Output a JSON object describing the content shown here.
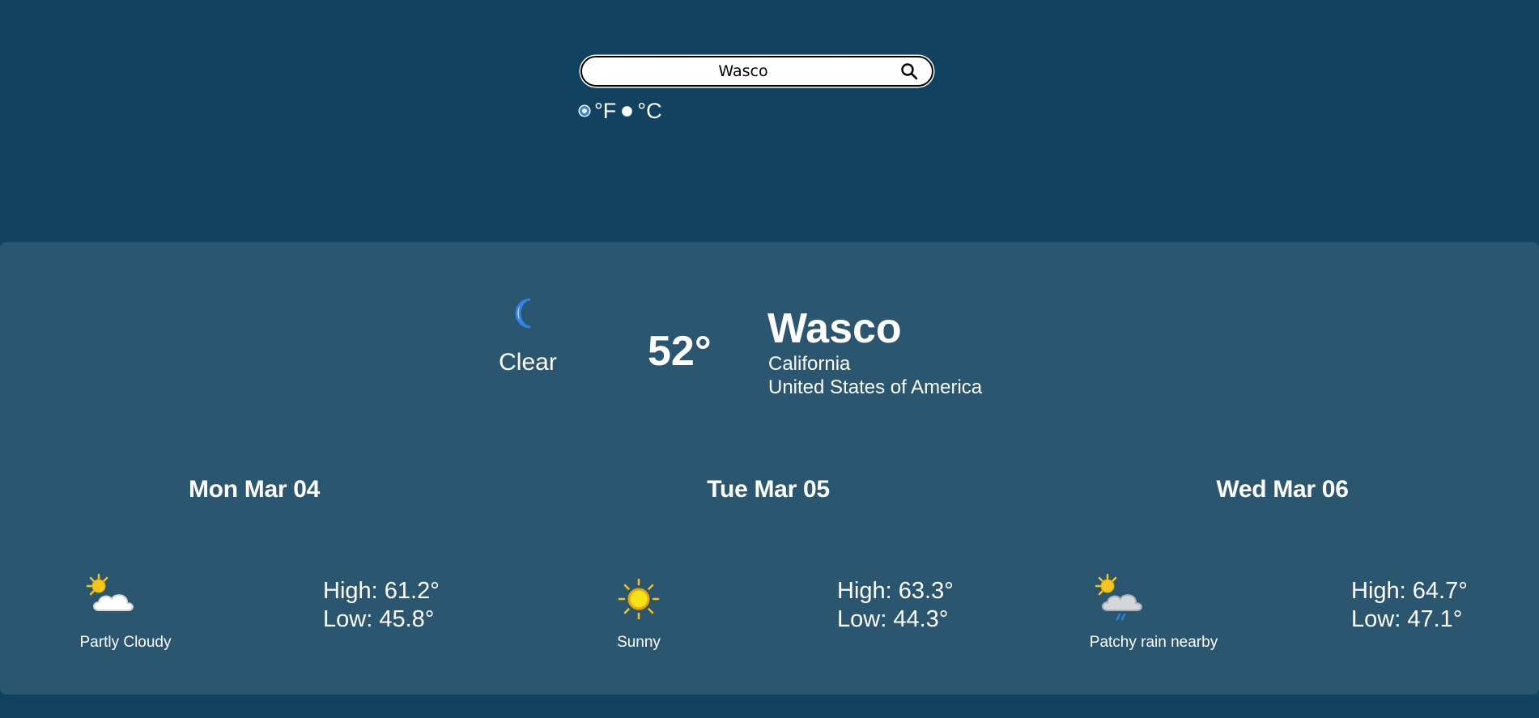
{
  "search": {
    "value": "Wasco",
    "icon": "search-icon"
  },
  "units": {
    "options": [
      {
        "label": "°F",
        "checked": true
      },
      {
        "label": "°C",
        "checked": false
      }
    ]
  },
  "current": {
    "icon": "crescent-moon-icon",
    "condition": "Clear",
    "temperature": "52°"
  },
  "location": {
    "city": "Wasco",
    "region": "California",
    "country": "United States of America"
  },
  "forecast": [
    {
      "date": "Mon Mar 04",
      "icon": "partly-cloudy-icon",
      "condition": "Partly Cloudy",
      "high": "High: 61.2°",
      "low": "Low: 45.8°"
    },
    {
      "date": "Tue Mar 05",
      "icon": "sun-icon",
      "condition": "Sunny",
      "high": "High: 63.3°",
      "low": "Low: 44.3°"
    },
    {
      "date": "Wed Mar 06",
      "icon": "patchy-rain-icon",
      "condition": "Patchy rain nearby",
      "high": "High: 64.7°",
      "low": "Low: 47.1°"
    }
  ],
  "colors": {
    "background": "#11425f",
    "panel": "#2a566f",
    "radio_accent": "#2f84e6",
    "sun": "#f5c518",
    "rain": "#2f84e6"
  }
}
